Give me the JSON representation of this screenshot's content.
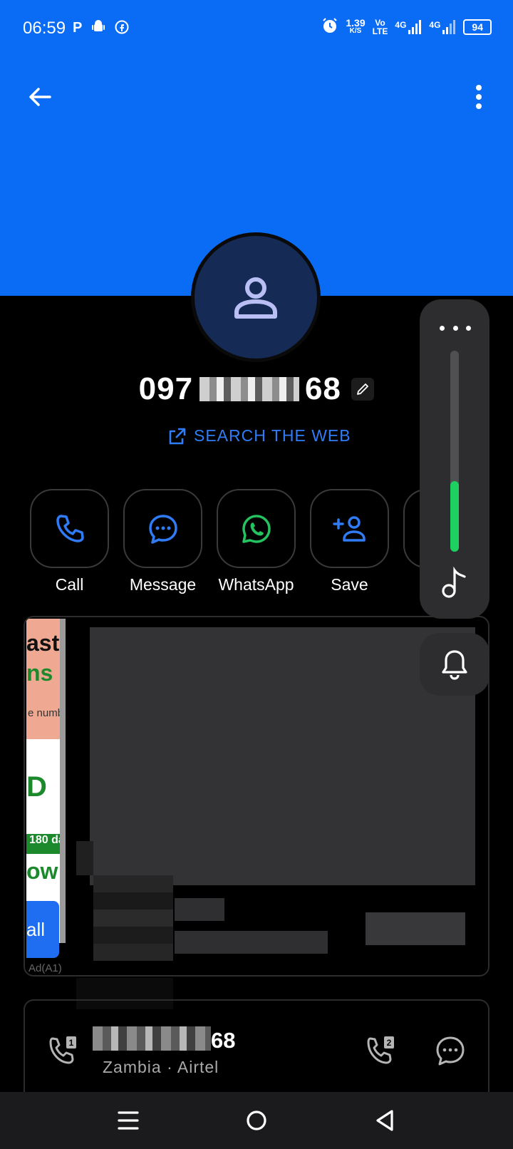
{
  "status": {
    "time": "06:59",
    "left_icons": [
      "p-icon",
      "android-icon",
      "facebook-icon"
    ],
    "speed_value": "1.39",
    "speed_unit": "K/S",
    "volte_top": "Vo",
    "volte_bottom": "LTE",
    "net1": "4G",
    "net2": "4G",
    "battery": "94"
  },
  "header": {
    "bg_color": "#0A6CF5"
  },
  "contact": {
    "number_prefix": "097",
    "number_suffix": "68",
    "search_web_label": "SEARCH THE WEB"
  },
  "actions": [
    {
      "label": "Call",
      "icon": "phone-icon"
    },
    {
      "label": "Message",
      "icon": "message-icon"
    },
    {
      "label": "WhatsApp",
      "icon": "whatsapp-icon"
    },
    {
      "label": "Save",
      "icon": "add-contact-icon"
    }
  ],
  "ad": {
    "text1": "ast",
    "text2": "ns",
    "text3": "e numb",
    "text4": "D",
    "text5": "180 da",
    "text6": "ow",
    "call_label": "all",
    "ad_label": "Ad(A1)"
  },
  "info": {
    "number_suffix": "68",
    "subtitle": "Zambia · Airtel"
  },
  "volume": {
    "level": 0.35,
    "accent": "#1ED060"
  },
  "colors": {
    "accent_blue": "#2F7CF6",
    "whatsapp_green": "#25C260"
  }
}
